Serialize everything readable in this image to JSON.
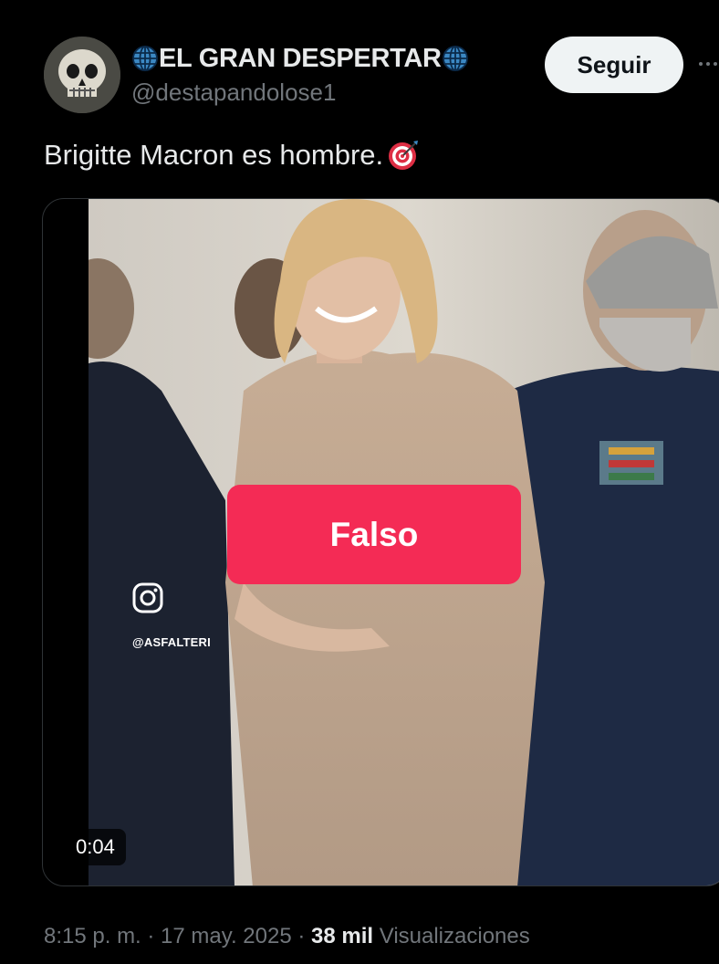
{
  "author": {
    "display_name": "EL GRAN DESPERTAR",
    "handle": "@destapandolose1"
  },
  "follow_button_label": "Seguir",
  "tweet_text": "Brigitte Macron es hombre.",
  "media": {
    "overlay_label": "Falso",
    "watermark_handle": "@ASFALTERI",
    "duration": "0:04"
  },
  "meta": {
    "time_date": "8:15 p. m. · 17 may. 2025 · ",
    "views_count": "38 mil",
    "views_label": " Visualizaciones"
  },
  "colors": {
    "background": "#000000",
    "text_primary": "#e7e9ea",
    "text_secondary": "#71767b",
    "overlay_badge": "#f42b55",
    "follow_button_bg": "#eff3f4"
  },
  "icons": [
    "globe-icon",
    "more-icon",
    "target-emoji-icon",
    "instagram-icon"
  ]
}
